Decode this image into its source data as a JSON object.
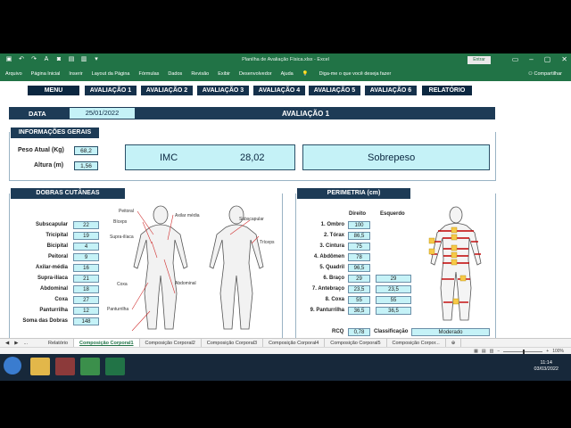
{
  "window": {
    "title": "Planilha de Avaliação Física.xlsx  -  Excel",
    "login_button": "Entrar"
  },
  "ribbon": {
    "tabs": [
      "Arquivo",
      "Página Inicial",
      "Inserir",
      "Layout da Página",
      "Fórmulas",
      "Dados",
      "Revisão",
      "Exibir",
      "Desenvolvedor",
      "Ajuda"
    ],
    "tell_me": "Diga-me o que você deseja fazer",
    "share": "Compartilhar"
  },
  "nav": {
    "menu": "MENU",
    "avaliacoes": [
      "AVALIAÇÃO 1",
      "AVALIAÇÃO 2",
      "AVALIAÇÃO 3",
      "AVALIAÇÃO 4",
      "AVALIAÇÃO 5",
      "AVALIAÇÃO 6"
    ],
    "relatorio": "RELATÓRIO"
  },
  "header": {
    "data_label": "DATA",
    "data_value": "25/01/2022",
    "title": "AVALIAÇÃO 1"
  },
  "gerais": {
    "title": "INFORMAÇÕES GERAIS",
    "peso_label": "Peso Atual (Kg)",
    "peso_value": "68,2",
    "altura_label": "Altura (m)",
    "altura_value": "1,56",
    "imc_label": "IMC",
    "imc_value": "28,02",
    "classificacao": "Sobrepeso"
  },
  "dobras": {
    "title": "DOBRAS CUTÂNEAS",
    "rows": [
      {
        "label": "Subscapular",
        "value": "22"
      },
      {
        "label": "Tricipital",
        "value": "19"
      },
      {
        "label": "Bicipital",
        "value": "4"
      },
      {
        "label": "Peitoral",
        "value": "9"
      },
      {
        "label": "Axilar-média",
        "value": "16"
      },
      {
        "label": "Supra-ilíaca",
        "value": "21"
      },
      {
        "label": "Abdominal",
        "value": "18"
      },
      {
        "label": "Coxa",
        "value": "27"
      },
      {
        "label": "Panturrilha",
        "value": "12"
      },
      {
        "label": "Soma das Dobras",
        "value": "148"
      }
    ],
    "figure_labels": [
      "Peitoral",
      "Bíceps",
      "Axilar média",
      "Supra-ilíaca",
      "Coxa",
      "Abdominal",
      "Panturrilha",
      "Subscapular",
      "Tríceps"
    ]
  },
  "perimetria": {
    "title": "PERIMETRIA (cm)",
    "col_direito": "Direito",
    "col_esquerdo": "Esquerdo",
    "rows": [
      {
        "label": "1. Ombro",
        "direito": "100",
        "esquerdo": ""
      },
      {
        "label": "2. Tórax",
        "direito": "86,5",
        "esquerdo": ""
      },
      {
        "label": "3. Cintura",
        "direito": "75",
        "esquerdo": ""
      },
      {
        "label": "4. Abdômen",
        "direito": "78",
        "esquerdo": ""
      },
      {
        "label": "5. Quadril",
        "direito": "96,5",
        "esquerdo": ""
      },
      {
        "label": "6. Braço",
        "direito": "29",
        "esquerdo": "29"
      },
      {
        "label": "7. Antebraço",
        "direito": "23,5",
        "esquerdo": "23,5"
      },
      {
        "label": "8. Coxa",
        "direito": "55",
        "esquerdo": "55"
      },
      {
        "label": "9. Panturrilha",
        "direito": "36,5",
        "esquerdo": "36,5"
      }
    ],
    "rcq_label": "RCQ",
    "rcq_value": "0,78",
    "classificacao_label": "Classificação",
    "classificacao_value": "Moderado"
  },
  "sheet_tabs": {
    "ellipsis": "...",
    "tabs": [
      "Relatório",
      "Composição Corporal1",
      "Composição Corporal2",
      "Composição Corporal3",
      "Composição Corporal4",
      "Composição Corporal5",
      "Composição Corpor..."
    ],
    "active_index": 1
  },
  "status": {
    "zoom": "100%"
  },
  "taskbar": {
    "time": "11:14",
    "date": "03/03/2022"
  },
  "colors": {
    "excel_green": "#217346",
    "navy": "#15314b",
    "cell_cyan": "#c5f2f7"
  }
}
